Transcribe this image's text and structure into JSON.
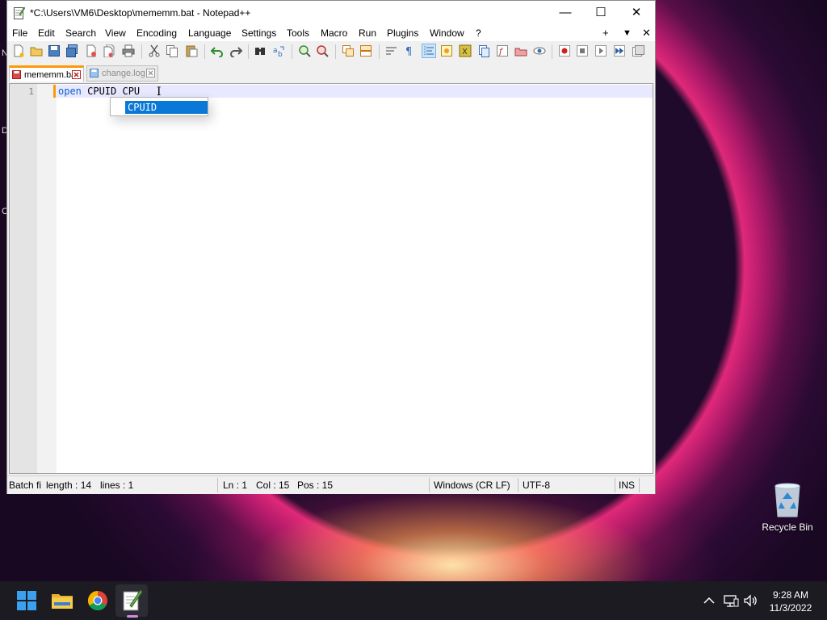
{
  "window": {
    "title": "*C:\\Users\\VM6\\Desktop\\mememm.bat - Notepad++",
    "controls": {
      "minimize": "—",
      "maximize": "☐",
      "close": "✕"
    }
  },
  "menu": {
    "items": [
      "File",
      "Edit",
      "Search",
      "View",
      "Encoding",
      "Language",
      "Settings",
      "Tools",
      "Macro",
      "Run",
      "Plugins",
      "Window",
      "?"
    ],
    "right": [
      "+",
      "▼",
      "✕"
    ]
  },
  "tabs": [
    {
      "label": "mememm.bat",
      "active": true,
      "icon": "floppy-disk-icon"
    },
    {
      "label": "change.log",
      "active": false,
      "icon": "file-icon"
    }
  ],
  "editor": {
    "line_number": "1",
    "code_keyword": "open",
    "code_rest": " CPUID CPU ",
    "cursor": "I"
  },
  "autocomplete": {
    "items": [
      "CPUID"
    ]
  },
  "status": {
    "file_type": "Batch fi",
    "length": "length : 14",
    "lines": "lines : 1",
    "ln": "Ln : 1",
    "col": "Col : 15",
    "pos": "Pos : 15",
    "eol": "Windows (CR LF)",
    "encoding": "UTF-8",
    "mode": "INS"
  },
  "desktop": {
    "recycle_bin_label": "Recycle Bin",
    "edge_letters": [
      "N",
      "D",
      "C"
    ]
  },
  "taskbar": {
    "time": "9:28 AM",
    "date": "11/3/2022"
  },
  "colors": {
    "accent_tab": "#fa9a0a",
    "selection": "#0a78d7",
    "keyword": "#1060d0",
    "taskbar": "#1c1b22"
  }
}
